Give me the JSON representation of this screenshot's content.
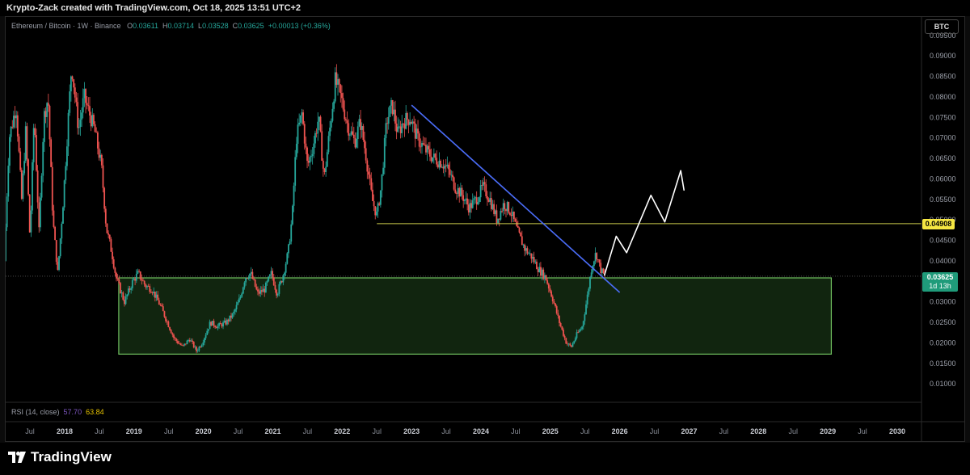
{
  "header": {
    "text": "Krypto-Zack created with TradingView.com, Oct 18, 2025 13:51 UTC+2"
  },
  "legend": {
    "symbol": "Ethereum / Bitcoin · 1W · Binance",
    "open_label": "O",
    "open": "0.03611",
    "high_label": "H",
    "high": "0.03714",
    "low_label": "L",
    "low": "0.03528",
    "close_label": "C",
    "close": "0.03625",
    "change": "+0.00013 (+0.36%)"
  },
  "currency_button": "BTC",
  "rsi": {
    "label": "RSI (14, close)",
    "value1": "57.70",
    "value2": "63.84"
  },
  "badges": {
    "level": "0.04908",
    "price": "0.03625",
    "countdown": "1d 13h"
  },
  "brand": "TradingView",
  "colors": {
    "up": "#26a69a",
    "down": "#ef5350",
    "zone_border": "#6fbf5f",
    "zone_fill": "#142b12",
    "trendline": "#4a6cf7",
    "level_line": "#c8c84a",
    "level_badge": "#f5e642",
    "price_badge": "#1f9b7a"
  },
  "chart_data": {
    "type": "candlestick",
    "title": "Ethereum / Bitcoin · 1W · Binance",
    "y_ticks": [
      "0.09500",
      "0.09000",
      "0.08500",
      "0.08000",
      "0.07500",
      "0.07000",
      "0.06500",
      "0.06000",
      "0.05500",
      "0.05000",
      "0.04500",
      "0.04000",
      "0.03500",
      "0.03000",
      "0.02500",
      "0.02000",
      "0.01500",
      "0.01000"
    ],
    "ylim": [
      0.0055,
      0.0995
    ],
    "x_ticks": [
      "Jul",
      "2018",
      "Jul",
      "2019",
      "Jul",
      "2020",
      "Jul",
      "2021",
      "Jul",
      "2022",
      "Jul",
      "2023",
      "Jul",
      "2024",
      "Jul",
      "2025",
      "Jul",
      "2026",
      "Jul",
      "2027",
      "Jul",
      "2028",
      "Jul",
      "2029",
      "Jul",
      "2030"
    ],
    "x_tick_times": [
      2017.5,
      2018,
      2018.5,
      2019,
      2019.5,
      2020,
      2020.5,
      2021,
      2021.5,
      2022,
      2022.5,
      2023,
      2023.5,
      2024,
      2024.5,
      2025,
      2025.5,
      2026,
      2026.5,
      2027,
      2027.5,
      2028,
      2028.5,
      2029,
      2029.5,
      2030
    ],
    "xlim": [
      2017.15,
      2030.35
    ],
    "price_path": [
      [
        2017.15,
        0.04
      ],
      [
        2017.22,
        0.07
      ],
      [
        2017.32,
        0.078
      ],
      [
        2017.4,
        0.055
      ],
      [
        2017.46,
        0.072
      ],
      [
        2017.52,
        0.045
      ],
      [
        2017.58,
        0.076
      ],
      [
        2017.65,
        0.047
      ],
      [
        2017.72,
        0.075
      ],
      [
        2017.78,
        0.08
      ],
      [
        2017.85,
        0.05
      ],
      [
        2017.92,
        0.037
      ],
      [
        2018.0,
        0.055
      ],
      [
        2018.12,
        0.088
      ],
      [
        2018.22,
        0.072
      ],
      [
        2018.3,
        0.08
      ],
      [
        2018.45,
        0.072
      ],
      [
        2018.55,
        0.063
      ],
      [
        2018.62,
        0.048
      ],
      [
        2018.7,
        0.042
      ],
      [
        2018.76,
        0.036
      ],
      [
        2018.88,
        0.03
      ],
      [
        2019.0,
        0.035
      ],
      [
        2019.08,
        0.037
      ],
      [
        2019.18,
        0.034
      ],
      [
        2019.28,
        0.033
      ],
      [
        2019.4,
        0.029
      ],
      [
        2019.5,
        0.025
      ],
      [
        2019.6,
        0.021
      ],
      [
        2019.72,
        0.019
      ],
      [
        2019.82,
        0.021
      ],
      [
        2019.92,
        0.018
      ],
      [
        2020.0,
        0.02
      ],
      [
        2020.12,
        0.025
      ],
      [
        2020.22,
        0.024
      ],
      [
        2020.35,
        0.025
      ],
      [
        2020.45,
        0.027
      ],
      [
        2020.55,
        0.031
      ],
      [
        2020.62,
        0.036
      ],
      [
        2020.7,
        0.037
      ],
      [
        2020.8,
        0.032
      ],
      [
        2020.9,
        0.033
      ],
      [
        2021.0,
        0.037
      ],
      [
        2021.08,
        0.032
      ],
      [
        2021.16,
        0.036
      ],
      [
        2021.24,
        0.042
      ],
      [
        2021.3,
        0.051
      ],
      [
        2021.36,
        0.07
      ],
      [
        2021.44,
        0.076
      ],
      [
        2021.52,
        0.063
      ],
      [
        2021.6,
        0.068
      ],
      [
        2021.68,
        0.075
      ],
      [
        2021.76,
        0.06
      ],
      [
        2021.84,
        0.072
      ],
      [
        2021.92,
        0.084
      ],
      [
        2022.0,
        0.08
      ],
      [
        2022.1,
        0.073
      ],
      [
        2022.2,
        0.069
      ],
      [
        2022.28,
        0.074
      ],
      [
        2022.36,
        0.066
      ],
      [
        2022.45,
        0.055
      ],
      [
        2022.52,
        0.051
      ],
      [
        2022.58,
        0.058
      ],
      [
        2022.66,
        0.074
      ],
      [
        2022.74,
        0.078
      ],
      [
        2022.82,
        0.071
      ],
      [
        2022.9,
        0.074
      ],
      [
        2023.0,
        0.075
      ],
      [
        2023.1,
        0.07
      ],
      [
        2023.22,
        0.067
      ],
      [
        2023.34,
        0.065
      ],
      [
        2023.46,
        0.064
      ],
      [
        2023.55,
        0.062
      ],
      [
        2023.65,
        0.058
      ],
      [
        2023.75,
        0.056
      ],
      [
        2023.85,
        0.053
      ],
      [
        2023.95,
        0.055
      ],
      [
        2024.05,
        0.058
      ],
      [
        2024.15,
        0.055
      ],
      [
        2024.25,
        0.05
      ],
      [
        2024.35,
        0.054
      ],
      [
        2024.45,
        0.052
      ],
      [
        2024.55,
        0.047
      ],
      [
        2024.65,
        0.043
      ],
      [
        2024.75,
        0.041
      ],
      [
        2024.85,
        0.038
      ],
      [
        2024.95,
        0.036
      ],
      [
        2025.05,
        0.031
      ],
      [
        2025.15,
        0.025
      ],
      [
        2025.25,
        0.02
      ],
      [
        2025.32,
        0.019
      ],
      [
        2025.4,
        0.022
      ],
      [
        2025.48,
        0.024
      ],
      [
        2025.55,
        0.031
      ],
      [
        2025.62,
        0.039
      ],
      [
        2025.68,
        0.042
      ],
      [
        2025.74,
        0.038
      ],
      [
        2025.8,
        0.03625
      ]
    ],
    "annotations": [
      {
        "type": "rectangle",
        "label": "demand-zone",
        "x": [
          2018.78,
          2029.05
        ],
        "y": [
          0.01725,
          0.03585
        ]
      },
      {
        "type": "trendline",
        "x": [
          2023.0,
          2026.0
        ],
        "y": [
          0.078,
          0.0323
        ]
      },
      {
        "type": "horizontal-level",
        "x_start": 2022.5,
        "y": 0.04908
      },
      {
        "type": "projection-arrow",
        "points": [
          [
            2025.78,
            0.0365
          ],
          [
            2025.95,
            0.046
          ],
          [
            2026.1,
            0.042
          ],
          [
            2026.45,
            0.056
          ],
          [
            2026.65,
            0.0495
          ],
          [
            2026.88,
            0.062
          ],
          [
            2026.82,
            0.06
          ],
          [
            2026.92,
            0.057
          ]
        ]
      }
    ],
    "rsi": {
      "period": 14,
      "source": "close",
      "values": [
        57.7,
        63.84
      ]
    },
    "grid": false
  }
}
